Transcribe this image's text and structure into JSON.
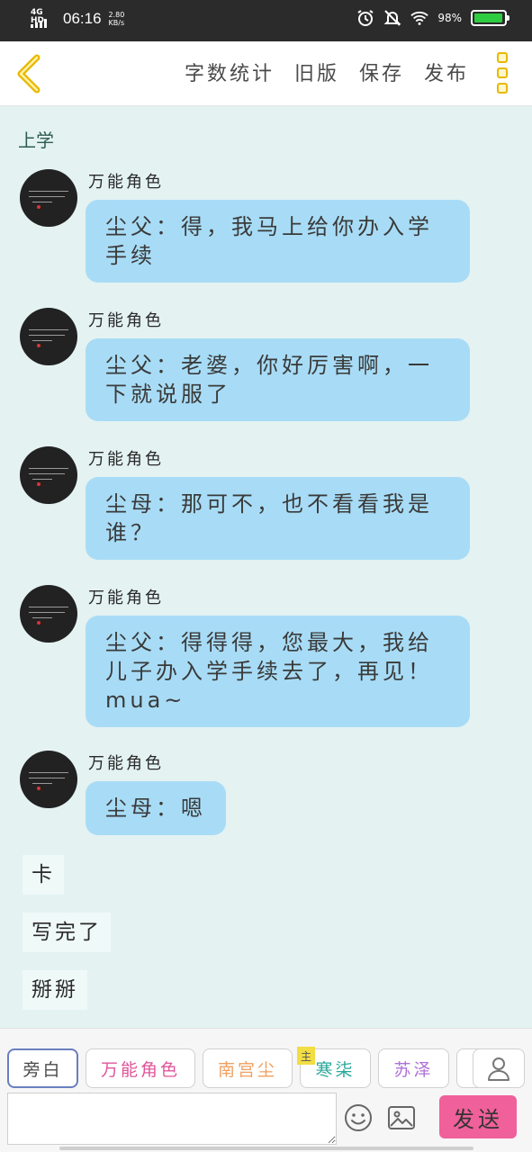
{
  "status_bar": {
    "network": "4G HD",
    "time": "06:16",
    "speed_value": "2.80",
    "speed_unit": "KB/s",
    "battery_percent": "98%",
    "battery_level": 0.98,
    "battery_color": "#2ecc40"
  },
  "header": {
    "actions": [
      "字数统计",
      "旧版",
      "保存",
      "发布"
    ],
    "back_icon": "chevron-left-icon",
    "menu_icon": "more-vertical-icon",
    "accent": "#e8b800"
  },
  "scene_title": "上学",
  "messages": [
    {
      "sender": "万能角色",
      "text": "尘父：得，我马上给你办入学手续"
    },
    {
      "sender": "万能角色",
      "text": "尘父：老婆，你好厉害啊，一下就说服了"
    },
    {
      "sender": "万能角色",
      "text": "尘母：那可不，也不看看我是谁？"
    },
    {
      "sender": "万能角色",
      "text": "尘父：得得得，您最大，我给儿子办入学手续去了，再见！mua~"
    },
    {
      "sender": "万能角色",
      "text": "尘母：嗯"
    }
  ],
  "notes": [
    "卡",
    "写完了",
    "掰掰"
  ],
  "roles": [
    {
      "label": "旁白",
      "color": "#4a4a4a",
      "active": true,
      "main": false
    },
    {
      "label": "万能角色",
      "color": "#e0559a",
      "active": false,
      "main": false
    },
    {
      "label": "南宫尘",
      "color": "#f0a060",
      "active": false,
      "main": false
    },
    {
      "label": "寒柒",
      "color": "#2aa89a",
      "active": false,
      "main": true,
      "main_tag": "主"
    },
    {
      "label": "苏泽",
      "color": "#b070d8",
      "active": false,
      "main": false
    }
  ],
  "input": {
    "placeholder": "",
    "send_label": "发送",
    "send_color": "#f0609a"
  }
}
